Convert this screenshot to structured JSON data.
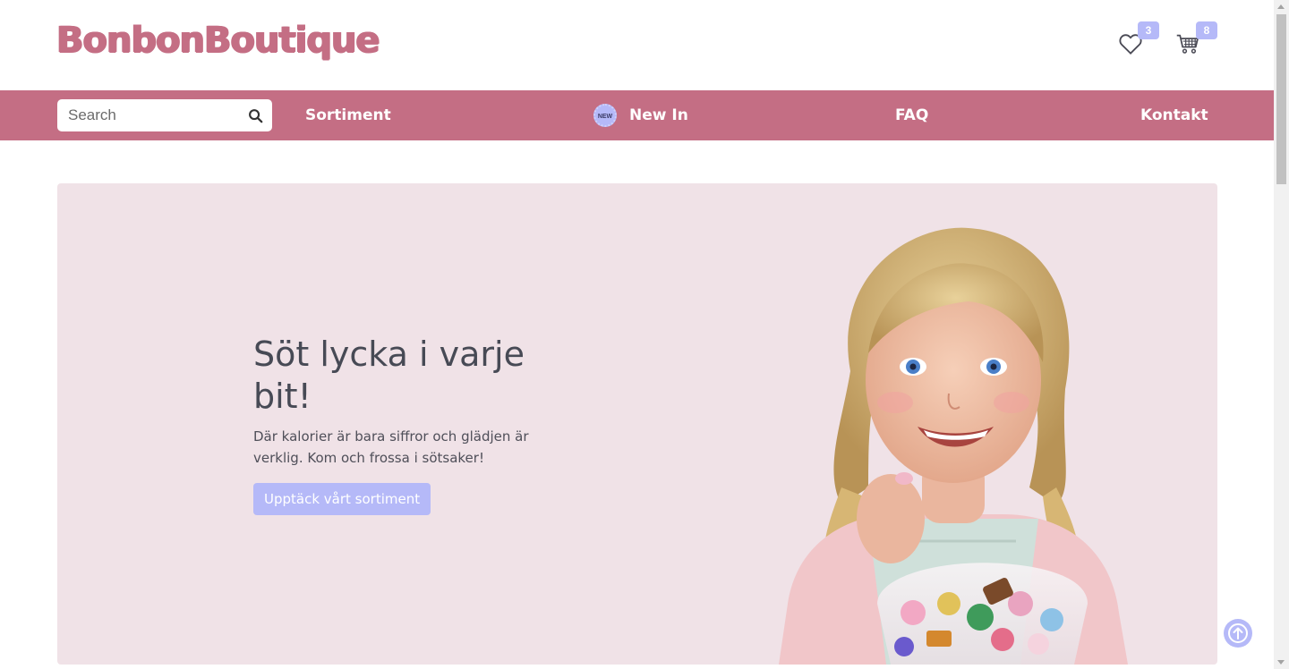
{
  "header": {
    "logo": "BonbonBoutique",
    "wishlist": {
      "icon": "heart-icon",
      "count": "3"
    },
    "cart": {
      "icon": "cart-icon",
      "count": "8"
    }
  },
  "nav": {
    "search_placeholder": "Search",
    "search_icon": "search-icon",
    "links": {
      "sortiment": "Sortiment",
      "new_in": "New In",
      "new_badge": "NEW",
      "faq": "FAQ",
      "kontakt": "Kontakt"
    }
  },
  "hero": {
    "title": "Söt lycka i varje bit!",
    "subtitle": "Där kalorier är bara siffror och glädjen är verklig. Kom och frossa i sötsaker!",
    "button": "Upptäck vårt sortiment"
  },
  "colors": {
    "brand": "#c46e84",
    "accent": "#b5b9f8",
    "hero_bg": "#f0e2e7"
  },
  "back_to_top_icon": "arrow-up-icon"
}
